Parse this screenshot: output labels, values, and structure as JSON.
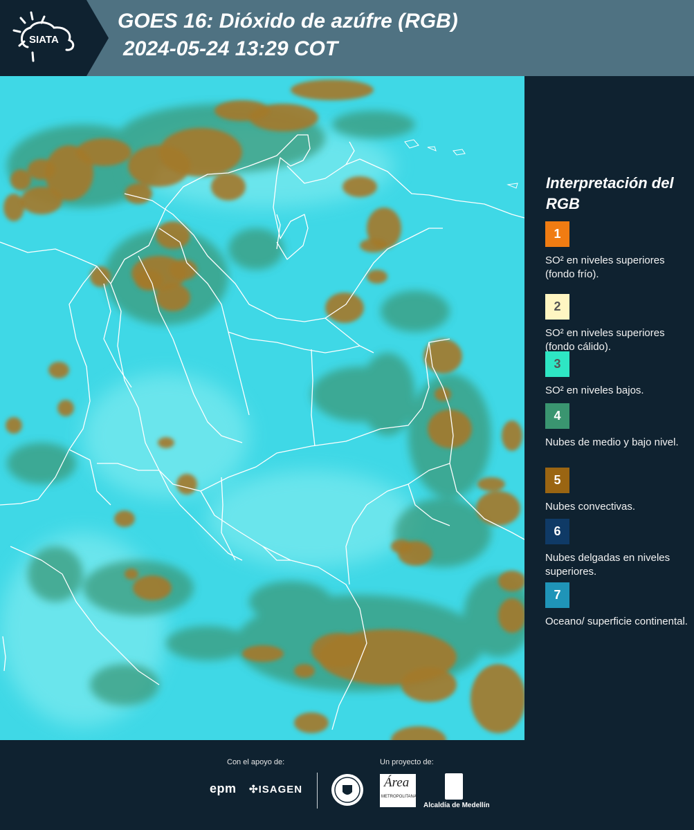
{
  "header": {
    "logo_text": "SIATA",
    "title_line1": "GOES 16: Dióxido de azúfre (RGB)",
    "title_line2": "2024-05-24 13:29 COT"
  },
  "map": {
    "background_color": "#3fd8e6",
    "cloud_color": "#a37a2a",
    "low_cloud_color": "#3a9a7a",
    "border_color": "#ffffff"
  },
  "legend": {
    "title": "Interpretación del RGB",
    "items": [
      {
        "number": "1",
        "color": "#f07c12",
        "text_color": "#ffffff",
        "label": "SO² en niveles superiores (fondo frío)."
      },
      {
        "number": "2",
        "color": "#fff6c2",
        "text_color": "#555555",
        "label": "SO² en niveles superiores (fondo cálido)."
      },
      {
        "number": "3",
        "color": "#2ee6c4",
        "text_color": "#555555",
        "label": "SO² en niveles bajos."
      },
      {
        "number": "4",
        "color": "#3a9570",
        "text_color": "#ffffff",
        "label": "Nubes de medio y bajo nivel."
      },
      {
        "number": "5",
        "color": "#9a6512",
        "text_color": "#ffffff",
        "label": "Nubes convectivas."
      },
      {
        "number": "6",
        "color": "#0f3a66",
        "text_color": "#ffffff",
        "label": "Nubes delgadas en niveles superiores."
      },
      {
        "number": "7",
        "color": "#1f94b8",
        "text_color": "#ffffff",
        "label": "Oceano/ superficie continental."
      }
    ]
  },
  "footer": {
    "support_label": "Con el apoyo de:",
    "project_label": "Un proyecto de:",
    "epm_text": "epm",
    "isagen_text": "ISAGEN",
    "area_text": "Área",
    "area_subtext": "METROPOLITANA",
    "alcaldia_text": "Alcaldía de Medellín"
  }
}
